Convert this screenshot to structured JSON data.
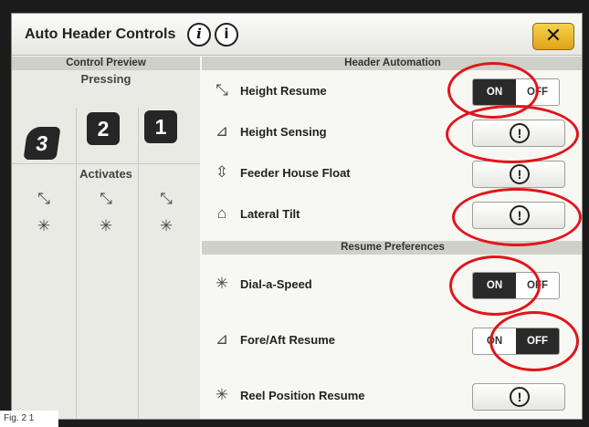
{
  "title": "Auto Header Controls",
  "info_icons": [
    "info-italic-icon",
    "info-icon"
  ],
  "close_icon": "close-icon",
  "left": {
    "header": "Control Preview",
    "pressing_label": "Pressing",
    "keys": [
      "3",
      "2",
      "1"
    ],
    "activates_label": "Activates"
  },
  "header_automation": {
    "title": "Header Automation",
    "rows": [
      {
        "label": "Height Resume",
        "icon": "height-resume-icon",
        "control": "toggle",
        "on": "ON",
        "off": "OFF",
        "state": "ON"
      },
      {
        "label": "Height Sensing",
        "icon": "height-sensing-icon",
        "control": "warning",
        "button_icon": "exclamation-icon"
      },
      {
        "label": "Feeder House Float",
        "icon": "feeder-house-float-icon",
        "control": "warning",
        "button_icon": "exclamation-icon"
      },
      {
        "label": "Lateral Tilt",
        "icon": "lateral-tilt-icon",
        "control": "warning",
        "button_icon": "exclamation-icon"
      }
    ]
  },
  "resume_preferences": {
    "title": "Resume Preferences",
    "rows": [
      {
        "label": "Dial-a-Speed",
        "icon": "dial-a-speed-icon",
        "control": "toggle",
        "on": "ON",
        "off": "OFF",
        "state": "ON"
      },
      {
        "label": "Fore/Aft Resume",
        "icon": "fore-aft-resume-icon",
        "control": "toggle",
        "on": "ON",
        "off": "OFF",
        "state": "OFF"
      },
      {
        "label": "Reel Position Resume",
        "icon": "reel-position-resume-icon",
        "control": "warning",
        "button_icon": "exclamation-icon"
      }
    ]
  },
  "annotation_color": "#e0161b",
  "caption": "Fig. 2 1"
}
